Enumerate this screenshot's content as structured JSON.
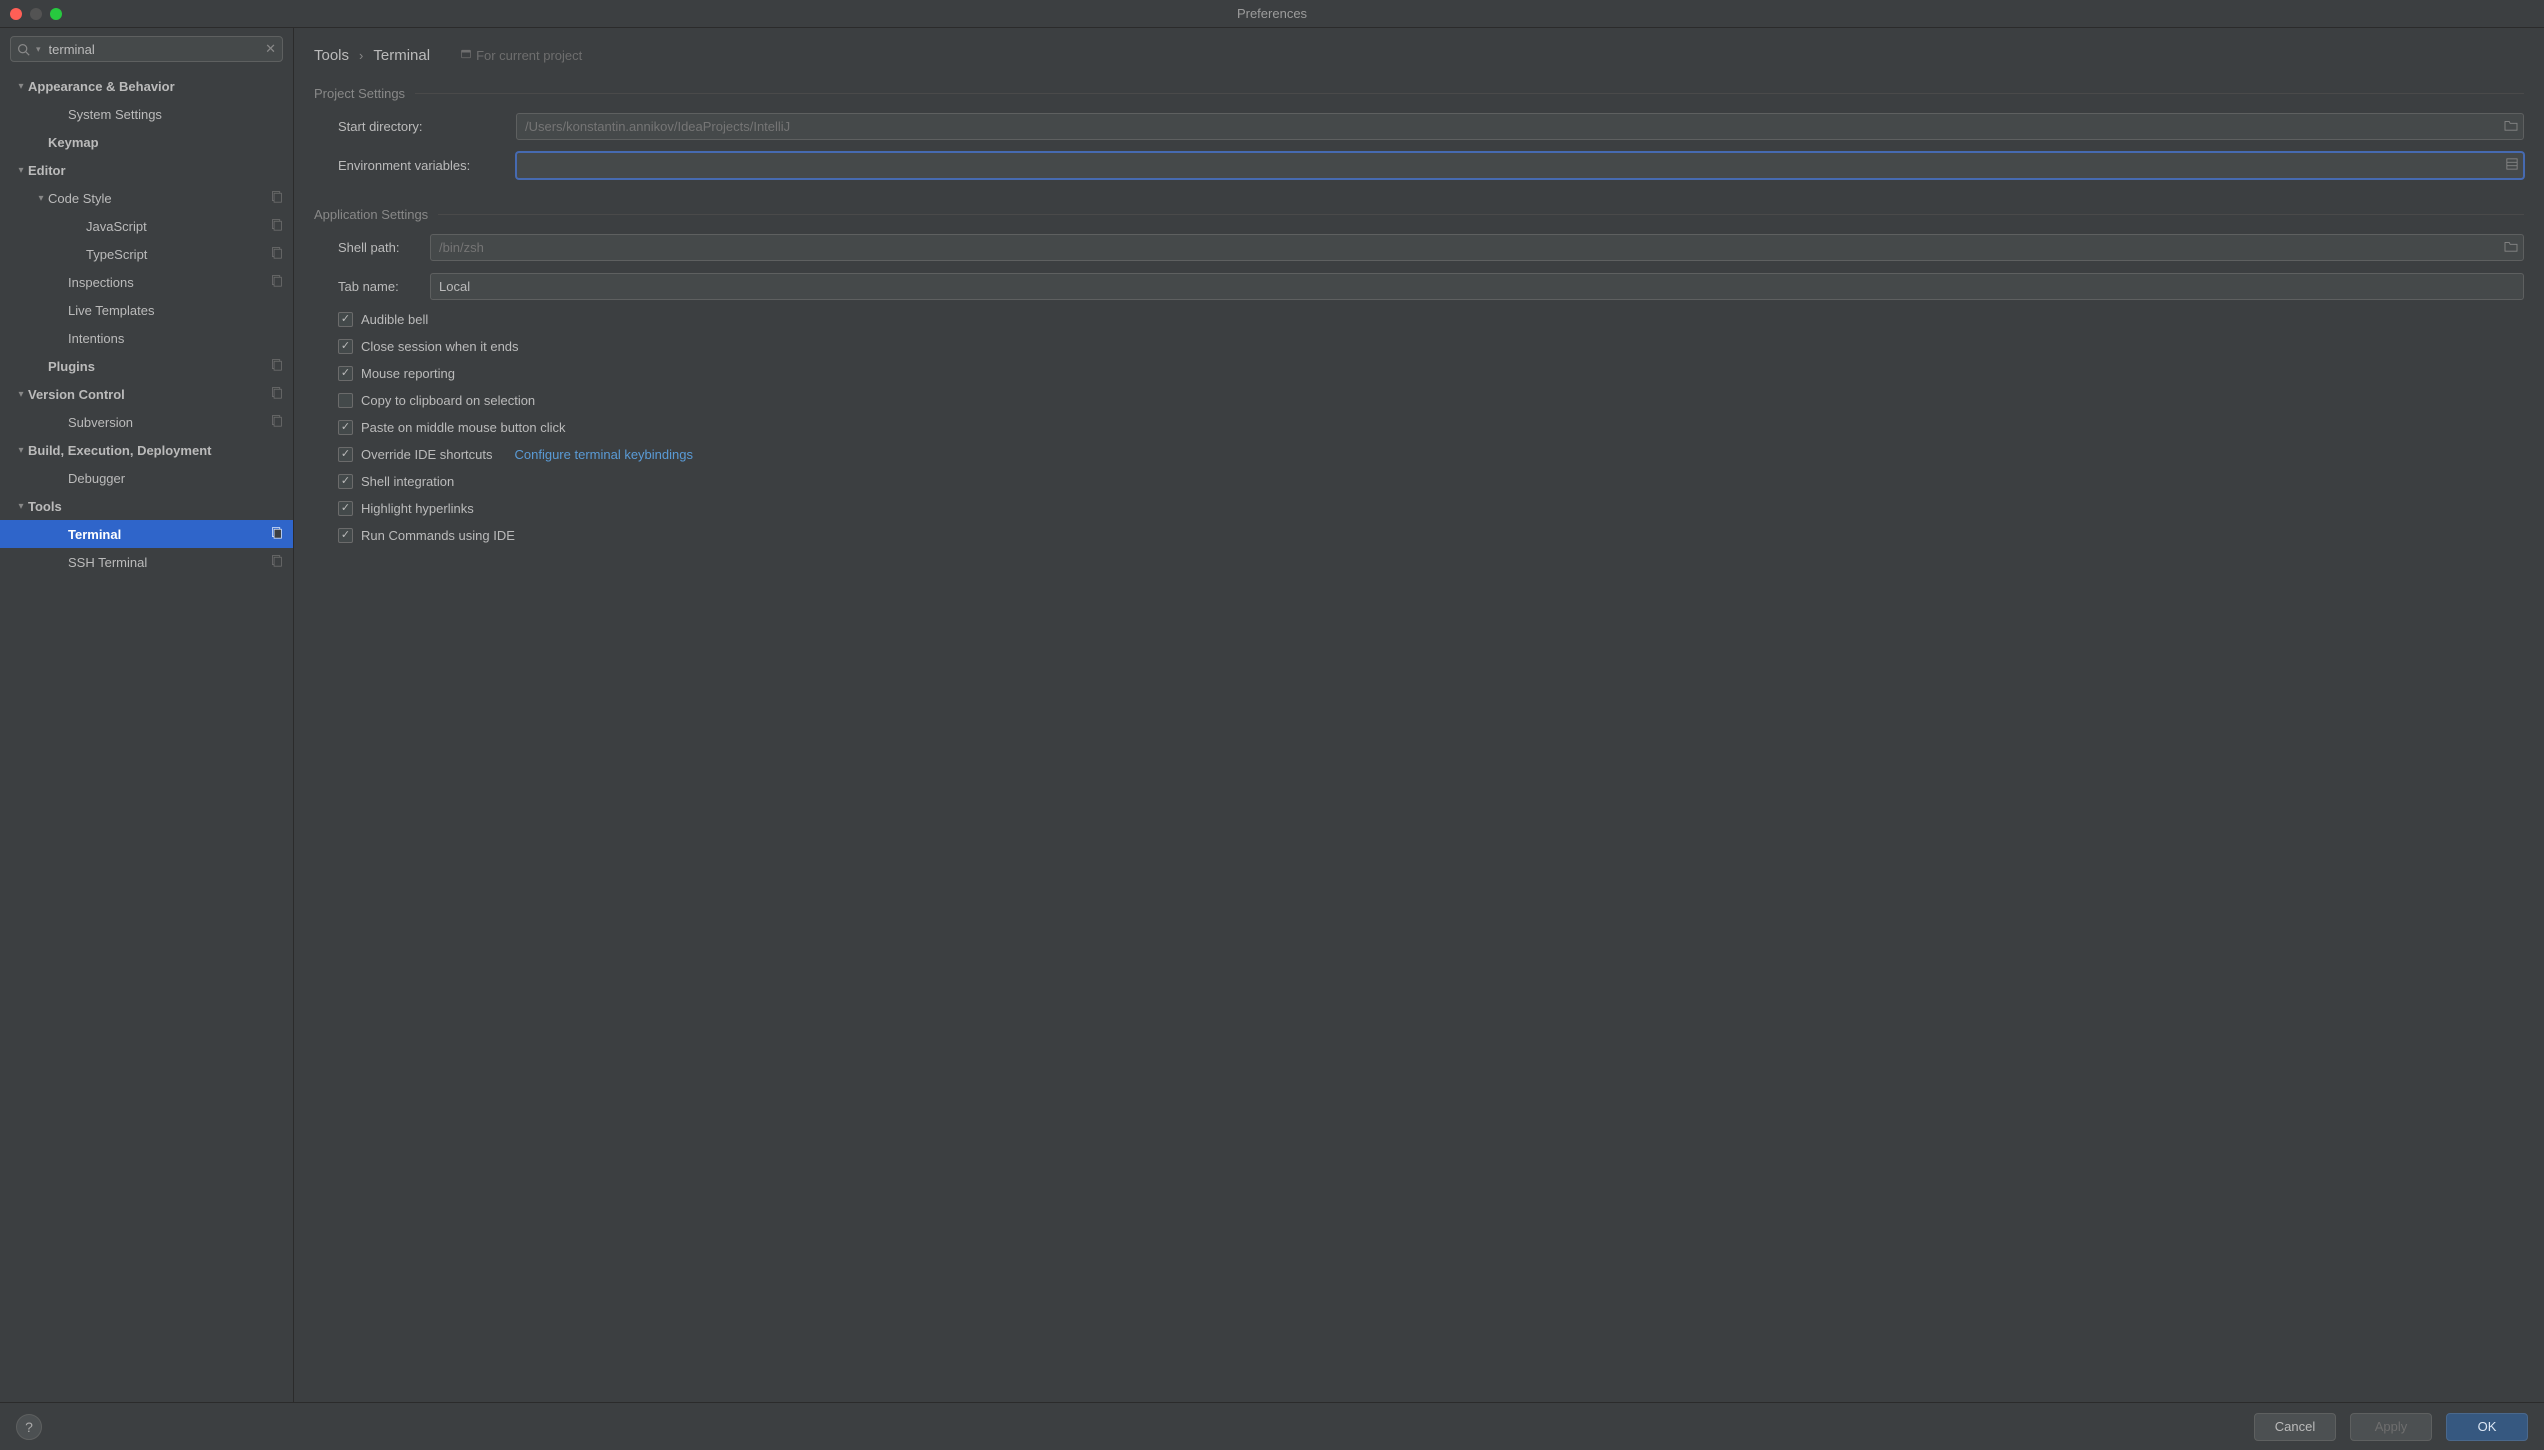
{
  "title": "Preferences",
  "search": {
    "value": "terminal"
  },
  "sidebar": {
    "items": [
      {
        "label": "Appearance & Behavior",
        "lvl": 0,
        "chev": "▾",
        "bold": true
      },
      {
        "label": "System Settings",
        "lvl": 2,
        "chev": "",
        "bold": false
      },
      {
        "label": "Keymap",
        "lvl": 1,
        "chev": "",
        "bold": true
      },
      {
        "label": "Editor",
        "lvl": 0,
        "chev": "▾",
        "bold": true
      },
      {
        "label": "Code Style",
        "lvl": 1,
        "chev": "▾",
        "bold": false,
        "badge": true
      },
      {
        "label": "JavaScript",
        "lvl": 3,
        "chev": "",
        "bold": false,
        "badge": true
      },
      {
        "label": "TypeScript",
        "lvl": 3,
        "chev": "",
        "bold": false,
        "badge": true
      },
      {
        "label": "Inspections",
        "lvl": 2,
        "chev": "",
        "bold": false,
        "badge": true
      },
      {
        "label": "Live Templates",
        "lvl": 2,
        "chev": "",
        "bold": false
      },
      {
        "label": "Intentions",
        "lvl": 2,
        "chev": "",
        "bold": false
      },
      {
        "label": "Plugins",
        "lvl": 1,
        "chev": "",
        "bold": true,
        "badge": true
      },
      {
        "label": "Version Control",
        "lvl": 0,
        "chev": "▾",
        "bold": true,
        "badge": true
      },
      {
        "label": "Subversion",
        "lvl": 2,
        "chev": "",
        "bold": false,
        "badge": true
      },
      {
        "label": "Build, Execution, Deployment",
        "lvl": 0,
        "chev": "▾",
        "bold": true
      },
      {
        "label": "Debugger",
        "lvl": 2,
        "chev": "",
        "bold": false
      },
      {
        "label": "Tools",
        "lvl": 0,
        "chev": "▾",
        "bold": true
      },
      {
        "label": "Terminal",
        "lvl": 2,
        "chev": "",
        "bold": true,
        "selected": true,
        "badge": true
      },
      {
        "label": "SSH Terminal",
        "lvl": 2,
        "chev": "",
        "bold": false,
        "badge": true
      }
    ]
  },
  "breadcrumb": {
    "a": "Tools",
    "b": "Terminal",
    "scope": "For current project"
  },
  "sections": {
    "project": {
      "title": "Project Settings",
      "start_dir_label": "Start directory:",
      "start_dir_placeholder": "/Users/konstantin.annikov/IdeaProjects/IntelliJ",
      "env_label": "Environment variables:",
      "env_value": ""
    },
    "app": {
      "title": "Application Settings",
      "shell_label": "Shell path:",
      "shell_placeholder": "/bin/zsh",
      "tab_label": "Tab name:",
      "tab_value": "Local",
      "checks": [
        {
          "label": "Audible bell",
          "on": true
        },
        {
          "label": "Close session when it ends",
          "on": true
        },
        {
          "label": "Mouse reporting",
          "on": true
        },
        {
          "label": "Copy to clipboard on selection",
          "on": false
        },
        {
          "label": "Paste on middle mouse button click",
          "on": true
        },
        {
          "label": "Override IDE shortcuts",
          "on": true,
          "link": "Configure terminal keybindings"
        },
        {
          "label": "Shell integration",
          "on": true
        },
        {
          "label": "Highlight hyperlinks",
          "on": true
        },
        {
          "label": "Run Commands using IDE",
          "on": true
        }
      ]
    }
  },
  "footer": {
    "cancel": "Cancel",
    "apply": "Apply",
    "ok": "OK"
  }
}
